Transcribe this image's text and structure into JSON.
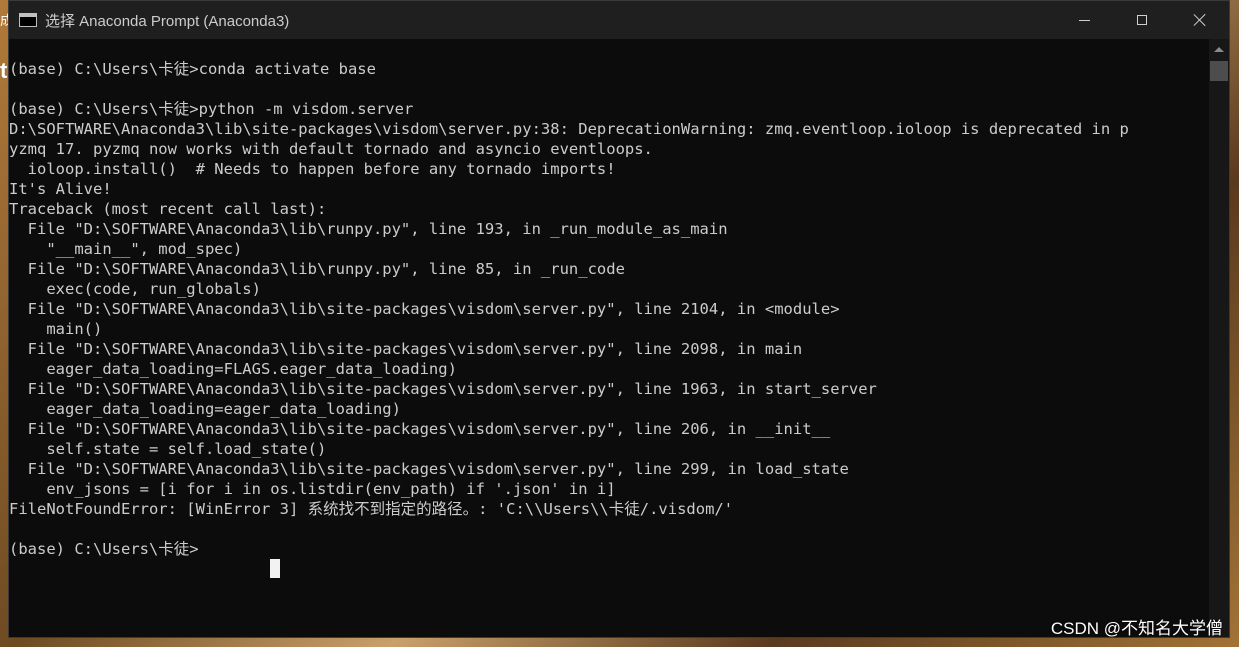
{
  "window": {
    "title": "选择 Anaconda Prompt (Anaconda3)"
  },
  "background": {
    "left_text_1": "成",
    "left_text_2": "t"
  },
  "console": {
    "lines": [
      "",
      "(base) C:\\Users\\卡徒>conda activate base",
      "",
      "(base) C:\\Users\\卡徒>python -m visdom.server",
      "D:\\SOFTWARE\\Anaconda3\\lib\\site-packages\\visdom\\server.py:38: DeprecationWarning: zmq.eventloop.ioloop is deprecated in p",
      "yzmq 17. pyzmq now works with default tornado and asyncio eventloops.",
      "  ioloop.install()  # Needs to happen before any tornado imports!",
      "It's Alive!",
      "Traceback (most recent call last):",
      "  File \"D:\\SOFTWARE\\Anaconda3\\lib\\runpy.py\", line 193, in _run_module_as_main",
      "    \"__main__\", mod_spec)",
      "  File \"D:\\SOFTWARE\\Anaconda3\\lib\\runpy.py\", line 85, in _run_code",
      "    exec(code, run_globals)",
      "  File \"D:\\SOFTWARE\\Anaconda3\\lib\\site-packages\\visdom\\server.py\", line 2104, in <module>",
      "    main()",
      "  File \"D:\\SOFTWARE\\Anaconda3\\lib\\site-packages\\visdom\\server.py\", line 2098, in main",
      "    eager_data_loading=FLAGS.eager_data_loading)",
      "  File \"D:\\SOFTWARE\\Anaconda3\\lib\\site-packages\\visdom\\server.py\", line 1963, in start_server",
      "    eager_data_loading=eager_data_loading)",
      "  File \"D:\\SOFTWARE\\Anaconda3\\lib\\site-packages\\visdom\\server.py\", line 206, in __init__",
      "    self.state = self.load_state()",
      "  File \"D:\\SOFTWARE\\Anaconda3\\lib\\site-packages\\visdom\\server.py\", line 299, in load_state",
      "    env_jsons = [i for i in os.listdir(env_path) if '.json' in i]",
      "FileNotFoundError: [WinError 3] 系统找不到指定的路径。: 'C:\\\\Users\\\\卡徒/.visdom/'",
      "",
      "(base) C:\\Users\\卡徒>"
    ]
  },
  "watermark": "CSDN @不知名大学僧",
  "colors": {
    "console_bg": "#0c0c0c",
    "console_text": "#cccccc",
    "titlebar_bg": "#1f1f1f"
  },
  "icons": {
    "app": "console-window-icon",
    "minimize": "minimize-icon",
    "maximize": "maximize-icon",
    "close": "close-icon"
  }
}
